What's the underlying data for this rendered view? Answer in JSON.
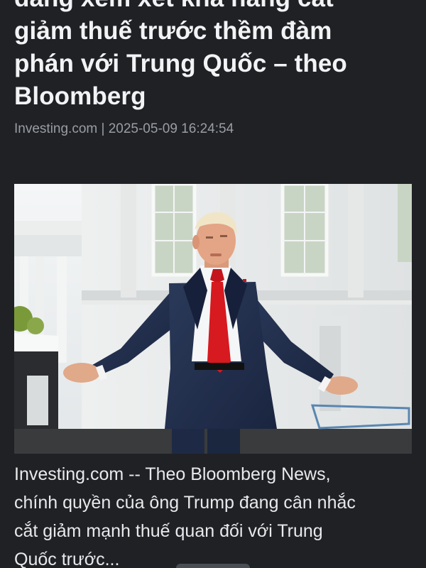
{
  "article": {
    "headline_lines": [
      "đang xem xét khả năng cắt",
      "giảm thuế trước thềm đàm",
      "phán với Trung Quốc – theo",
      "Bloomberg"
    ],
    "meta": "Investing.com | 2025-05-09 16:24:54",
    "summary_lines": [
      "Investing.com -- Theo Bloomberg News,",
      "chính quyền của ông Trump đang cân nhắc",
      "cắt giảm mạnh thuế quan đối với Trung",
      "Quốc trước..."
    ]
  },
  "colors": {
    "background": "#1f2125",
    "headline": "#f2f3f5",
    "meta": "#9a9da3",
    "body": "#e8e9eb"
  }
}
